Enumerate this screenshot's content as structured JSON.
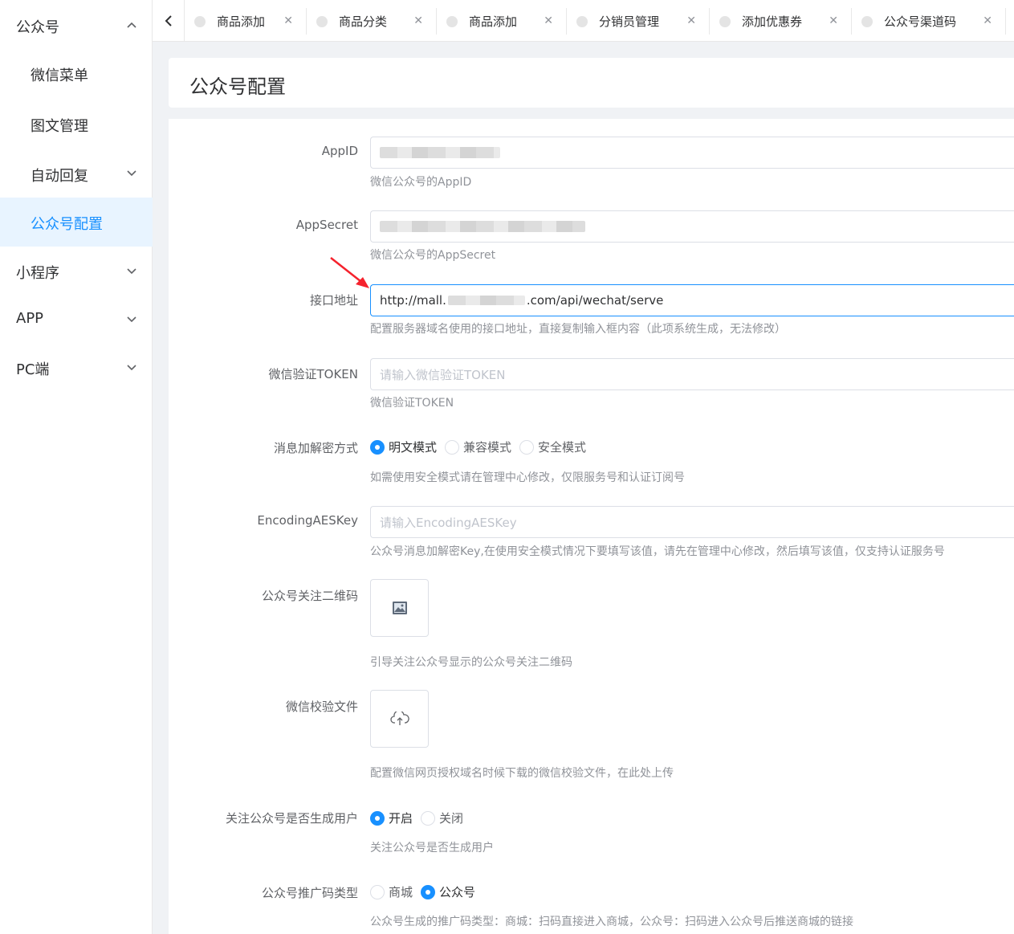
{
  "sidebar": {
    "groups": [
      {
        "label": "公众号",
        "expanded": true
      },
      {
        "label": "小程序"
      },
      {
        "label": "APP"
      },
      {
        "label": "PC端"
      }
    ],
    "sub_items": [
      {
        "label": "微信菜单"
      },
      {
        "label": "图文管理"
      },
      {
        "label": "自动回复",
        "has_children": true
      },
      {
        "label": "公众号配置",
        "active": true
      }
    ]
  },
  "tabs": [
    {
      "label": "商品添加"
    },
    {
      "label": "商品分类"
    },
    {
      "label": "商品添加"
    },
    {
      "label": "分销员管理"
    },
    {
      "label": "添加优惠券"
    },
    {
      "label": "公众号渠道码"
    }
  ],
  "page": {
    "title": "公众号配置"
  },
  "form": {
    "appid": {
      "label": "AppID",
      "tip": "微信公众号的AppID"
    },
    "appsecret": {
      "label": "AppSecret",
      "tip": "微信公众号的AppSecret"
    },
    "api_url": {
      "label": "接口地址",
      "value_prefix": "http://mall.",
      "value_suffix": ".com/api/wechat/serve",
      "tip": "配置服务器域名使用的接口地址，直接复制输入框内容（此项系统生成，无法修改）"
    },
    "token": {
      "label": "微信验证TOKEN",
      "placeholder": "请输入微信验证TOKEN",
      "tip": "微信验证TOKEN"
    },
    "encrypt_mode": {
      "label": "消息加解密方式",
      "options": [
        "明文模式",
        "兼容模式",
        "安全模式"
      ],
      "selected": "明文模式",
      "tip": "如需使用安全模式请在管理中心修改，仅限服务号和认证订阅号"
    },
    "aes_key": {
      "label": "EncodingAESKey",
      "placeholder": "请输入EncodingAESKey",
      "tip": "公众号消息加解密Key,在使用安全模式情况下要填写该值，请先在管理中心修改，然后填写该值，仅支持认证服务号"
    },
    "qrcode": {
      "label": "公众号关注二维码",
      "tip": "引导关注公众号显示的公众号关注二维码",
      "icon": "image-icon"
    },
    "verify_file": {
      "label": "微信校验文件",
      "tip": "配置微信网页授权域名时候下载的微信校验文件，在此处上传",
      "icon": "cloud-upload-icon"
    },
    "follow_create_user": {
      "label": "关注公众号是否生成用户",
      "options": [
        "开启",
        "关闭"
      ],
      "selected": "开启",
      "tip": "关注公众号是否生成用户"
    },
    "promo_type": {
      "label": "公众号推广码类型",
      "options": [
        "商城",
        "公众号"
      ],
      "selected": "公众号",
      "tip": "公众号生成的推广码类型：商城：扫码直接进入商城，公众号：扫码进入公众号后推送商城的链接"
    }
  },
  "colors": {
    "accent": "#1890ff",
    "annotation_arrow": "#f5222d"
  }
}
